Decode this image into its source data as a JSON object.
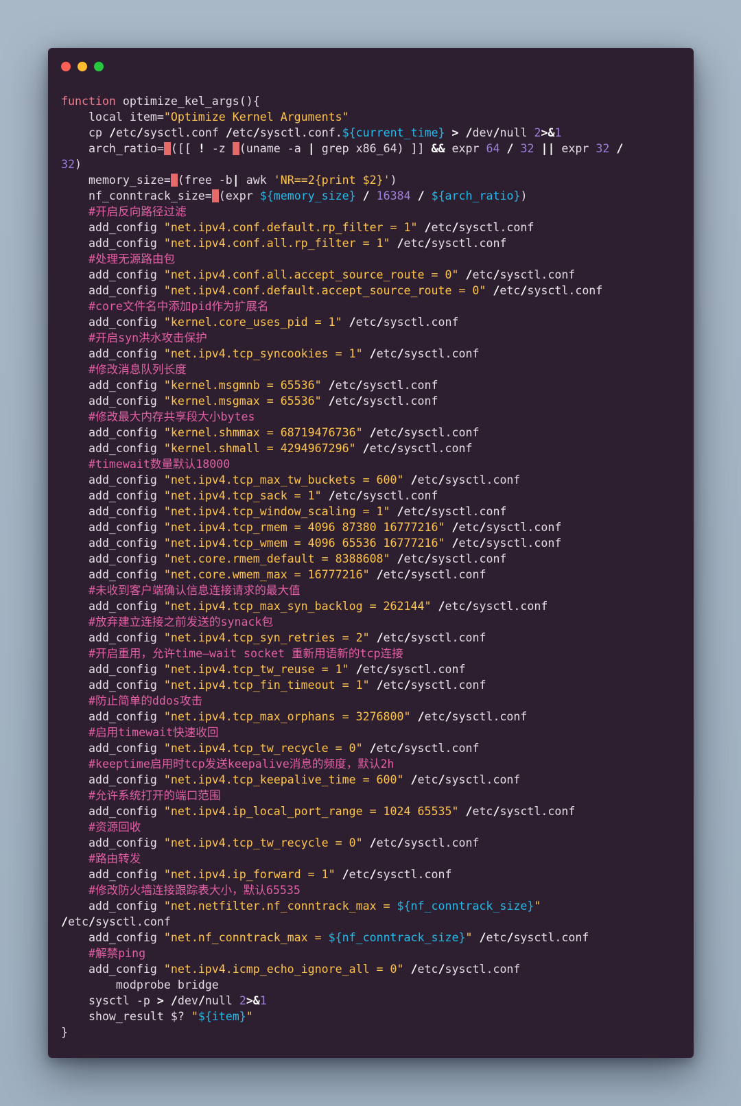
{
  "window": {
    "controls": [
      {
        "name": "close",
        "color": "#fd5f57"
      },
      {
        "name": "minimize",
        "color": "#febc2e"
      },
      {
        "name": "maximize",
        "color": "#27c840"
      }
    ]
  },
  "colors": {
    "background": "#2d1f2f",
    "keyword": "#f27d8e",
    "string": "#fcc34e",
    "variable": "#25b8e8",
    "number": "#9f7fd9",
    "comment": "#e35fa5",
    "text": "#e5dce6"
  },
  "code": {
    "lines": [
      [
        [
          "kw",
          "function"
        ],
        [
          "t",
          " optimize_kel_args(){"
        ]
      ],
      [
        [
          "t",
          "    local item="
        ],
        [
          "str",
          "\"Optimize Kernel Arguments\""
        ]
      ],
      [
        [
          "t",
          "    cp "
        ],
        [
          "op",
          "/"
        ],
        [
          "t",
          "etc"
        ],
        [
          "op",
          "/"
        ],
        [
          "t",
          "sysctl.conf "
        ],
        [
          "op",
          "/"
        ],
        [
          "t",
          "etc"
        ],
        [
          "op",
          "/"
        ],
        [
          "t",
          "sysctl.conf."
        ],
        [
          "var",
          "${current_time}"
        ],
        [
          "t",
          " "
        ],
        [
          "op",
          ">"
        ],
        [
          "t",
          " "
        ],
        [
          "op",
          "/"
        ],
        [
          "t",
          "dev"
        ],
        [
          "op",
          "/"
        ],
        [
          "t",
          "null "
        ],
        [
          "num",
          "2"
        ],
        [
          "op",
          ">&"
        ],
        [
          "num",
          "1"
        ]
      ],
      [
        [
          "t",
          "    arch_ratio="
        ],
        [
          "hl",
          "$"
        ],
        [
          "t",
          "([[ "
        ],
        [
          "op",
          "!"
        ],
        [
          "t",
          " -z "
        ],
        [
          "hl",
          "$"
        ],
        [
          "t",
          "(uname -a "
        ],
        [
          "op",
          "|"
        ],
        [
          "t",
          " grep x86_64) ]] "
        ],
        [
          "op",
          "&&"
        ],
        [
          "t",
          " expr "
        ],
        [
          "num",
          "64"
        ],
        [
          "t",
          " "
        ],
        [
          "op",
          "/"
        ],
        [
          "t",
          " "
        ],
        [
          "num",
          "32"
        ],
        [
          "t",
          " "
        ],
        [
          "op",
          "||"
        ],
        [
          "t",
          " expr "
        ],
        [
          "num",
          "32"
        ],
        [
          "t",
          " "
        ],
        [
          "op",
          "/"
        ]
      ],
      [
        [
          "num",
          "32"
        ],
        [
          "t",
          ")"
        ]
      ],
      [
        [
          "t",
          "    memory_size="
        ],
        [
          "hl",
          "$"
        ],
        [
          "t",
          "(free -b"
        ],
        [
          "op",
          "|"
        ],
        [
          "t",
          " awk "
        ],
        [
          "str",
          "'NR==2{print $2}'"
        ],
        [
          "t",
          ")"
        ]
      ],
      [
        [
          "t",
          "    nf_conntrack_size="
        ],
        [
          "hl",
          "$"
        ],
        [
          "t",
          "(expr "
        ],
        [
          "var",
          "${memory_size}"
        ],
        [
          "t",
          " "
        ],
        [
          "op",
          "/"
        ],
        [
          "t",
          " "
        ],
        [
          "num",
          "16384"
        ],
        [
          "t",
          " "
        ],
        [
          "op",
          "/"
        ],
        [
          "t",
          " "
        ],
        [
          "var",
          "${arch_ratio}"
        ],
        [
          "t",
          ")"
        ]
      ],
      [
        [
          "cmt",
          "    #开启反向路径过滤"
        ]
      ],
      [
        [
          "t",
          "    add_config "
        ],
        [
          "str",
          "\"net.ipv4.conf.default.rp_filter = 1\""
        ],
        [
          "t",
          " "
        ],
        [
          "op",
          "/"
        ],
        [
          "t",
          "etc"
        ],
        [
          "op",
          "/"
        ],
        [
          "t",
          "sysctl.conf"
        ]
      ],
      [
        [
          "t",
          "    add_config "
        ],
        [
          "str",
          "\"net.ipv4.conf.all.rp_filter = 1\""
        ],
        [
          "t",
          " "
        ],
        [
          "op",
          "/"
        ],
        [
          "t",
          "etc"
        ],
        [
          "op",
          "/"
        ],
        [
          "t",
          "sysctl.conf"
        ]
      ],
      [
        [
          "cmt",
          "    #处理无源路由包"
        ]
      ],
      [
        [
          "t",
          "    add_config "
        ],
        [
          "str",
          "\"net.ipv4.conf.all.accept_source_route = 0\""
        ],
        [
          "t",
          " "
        ],
        [
          "op",
          "/"
        ],
        [
          "t",
          "etc"
        ],
        [
          "op",
          "/"
        ],
        [
          "t",
          "sysctl.conf"
        ]
      ],
      [
        [
          "t",
          "    add_config "
        ],
        [
          "str",
          "\"net.ipv4.conf.default.accept_source_route = 0\""
        ],
        [
          "t",
          " "
        ],
        [
          "op",
          "/"
        ],
        [
          "t",
          "etc"
        ],
        [
          "op",
          "/"
        ],
        [
          "t",
          "sysctl.conf"
        ]
      ],
      [
        [
          "cmt",
          "    #core文件名中添加pid作为扩展名"
        ]
      ],
      [
        [
          "t",
          "    add_config "
        ],
        [
          "str",
          "\"kernel.core_uses_pid = 1\""
        ],
        [
          "t",
          " "
        ],
        [
          "op",
          "/"
        ],
        [
          "t",
          "etc"
        ],
        [
          "op",
          "/"
        ],
        [
          "t",
          "sysctl.conf"
        ]
      ],
      [
        [
          "cmt",
          "    #开启syn洪水攻击保护"
        ]
      ],
      [
        [
          "t",
          "    add_config "
        ],
        [
          "str",
          "\"net.ipv4.tcp_syncookies = 1\""
        ],
        [
          "t",
          " "
        ],
        [
          "op",
          "/"
        ],
        [
          "t",
          "etc"
        ],
        [
          "op",
          "/"
        ],
        [
          "t",
          "sysctl.conf"
        ]
      ],
      [
        [
          "cmt",
          "    #修改消息队列长度"
        ]
      ],
      [
        [
          "t",
          "    add_config "
        ],
        [
          "str",
          "\"kernel.msgmnb = 65536\""
        ],
        [
          "t",
          " "
        ],
        [
          "op",
          "/"
        ],
        [
          "t",
          "etc"
        ],
        [
          "op",
          "/"
        ],
        [
          "t",
          "sysctl.conf"
        ]
      ],
      [
        [
          "t",
          "    add_config "
        ],
        [
          "str",
          "\"kernel.msgmax = 65536\""
        ],
        [
          "t",
          " "
        ],
        [
          "op",
          "/"
        ],
        [
          "t",
          "etc"
        ],
        [
          "op",
          "/"
        ],
        [
          "t",
          "sysctl.conf"
        ]
      ],
      [
        [
          "cmt",
          "    #修改最大内存共享段大小bytes"
        ]
      ],
      [
        [
          "t",
          "    add_config "
        ],
        [
          "str",
          "\"kernel.shmmax = 68719476736\""
        ],
        [
          "t",
          " "
        ],
        [
          "op",
          "/"
        ],
        [
          "t",
          "etc"
        ],
        [
          "op",
          "/"
        ],
        [
          "t",
          "sysctl.conf"
        ]
      ],
      [
        [
          "t",
          "    add_config "
        ],
        [
          "str",
          "\"kernel.shmall = 4294967296\""
        ],
        [
          "t",
          " "
        ],
        [
          "op",
          "/"
        ],
        [
          "t",
          "etc"
        ],
        [
          "op",
          "/"
        ],
        [
          "t",
          "sysctl.conf"
        ]
      ],
      [
        [
          "cmt",
          "    #timewait数量默认18000"
        ]
      ],
      [
        [
          "t",
          "    add_config "
        ],
        [
          "str",
          "\"net.ipv4.tcp_max_tw_buckets = 600\""
        ],
        [
          "t",
          " "
        ],
        [
          "op",
          "/"
        ],
        [
          "t",
          "etc"
        ],
        [
          "op",
          "/"
        ],
        [
          "t",
          "sysctl.conf"
        ]
      ],
      [
        [
          "t",
          "    add_config "
        ],
        [
          "str",
          "\"net.ipv4.tcp_sack = 1\""
        ],
        [
          "t",
          " "
        ],
        [
          "op",
          "/"
        ],
        [
          "t",
          "etc"
        ],
        [
          "op",
          "/"
        ],
        [
          "t",
          "sysctl.conf"
        ]
      ],
      [
        [
          "t",
          "    add_config "
        ],
        [
          "str",
          "\"net.ipv4.tcp_window_scaling = 1\""
        ],
        [
          "t",
          " "
        ],
        [
          "op",
          "/"
        ],
        [
          "t",
          "etc"
        ],
        [
          "op",
          "/"
        ],
        [
          "t",
          "sysctl.conf"
        ]
      ],
      [
        [
          "t",
          "    add_config "
        ],
        [
          "str",
          "\"net.ipv4.tcp_rmem = 4096 87380 16777216\""
        ],
        [
          "t",
          " "
        ],
        [
          "op",
          "/"
        ],
        [
          "t",
          "etc"
        ],
        [
          "op",
          "/"
        ],
        [
          "t",
          "sysctl.conf"
        ]
      ],
      [
        [
          "t",
          "    add_config "
        ],
        [
          "str",
          "\"net.ipv4.tcp_wmem = 4096 65536 16777216\""
        ],
        [
          "t",
          " "
        ],
        [
          "op",
          "/"
        ],
        [
          "t",
          "etc"
        ],
        [
          "op",
          "/"
        ],
        [
          "t",
          "sysctl.conf"
        ]
      ],
      [
        [
          "t",
          "    add_config "
        ],
        [
          "str",
          "\"net.core.rmem_default = 8388608\""
        ],
        [
          "t",
          " "
        ],
        [
          "op",
          "/"
        ],
        [
          "t",
          "etc"
        ],
        [
          "op",
          "/"
        ],
        [
          "t",
          "sysctl.conf"
        ]
      ],
      [
        [
          "t",
          "    add_config "
        ],
        [
          "str",
          "\"net.core.wmem_max = 16777216\""
        ],
        [
          "t",
          " "
        ],
        [
          "op",
          "/"
        ],
        [
          "t",
          "etc"
        ],
        [
          "op",
          "/"
        ],
        [
          "t",
          "sysctl.conf"
        ]
      ],
      [
        [
          "cmt",
          "    #未收到客户端确认信息连接请求的最大值"
        ]
      ],
      [
        [
          "t",
          "    add_config "
        ],
        [
          "str",
          "\"net.ipv4.tcp_max_syn_backlog = 262144\""
        ],
        [
          "t",
          " "
        ],
        [
          "op",
          "/"
        ],
        [
          "t",
          "etc"
        ],
        [
          "op",
          "/"
        ],
        [
          "t",
          "sysctl.conf"
        ]
      ],
      [
        [
          "cmt",
          "    #放弃建立连接之前发送的synack包"
        ]
      ],
      [
        [
          "t",
          "    add_config "
        ],
        [
          "str",
          "\"net.ipv4.tcp_syn_retries = 2\""
        ],
        [
          "t",
          " "
        ],
        [
          "op",
          "/"
        ],
        [
          "t",
          "etc"
        ],
        [
          "op",
          "/"
        ],
        [
          "t",
          "sysctl.conf"
        ]
      ],
      [
        [
          "cmt",
          "    #开启重用，允许time—wait socket 重新用语新的tcp连接"
        ]
      ],
      [
        [
          "t",
          "    add_config "
        ],
        [
          "str",
          "\"net.ipv4.tcp_tw_reuse = 1\""
        ],
        [
          "t",
          " "
        ],
        [
          "op",
          "/"
        ],
        [
          "t",
          "etc"
        ],
        [
          "op",
          "/"
        ],
        [
          "t",
          "sysctl.conf"
        ]
      ],
      [
        [
          "t",
          "    add_config "
        ],
        [
          "str",
          "\"net.ipv4.tcp_fin_timeout = 1\""
        ],
        [
          "t",
          " "
        ],
        [
          "op",
          "/"
        ],
        [
          "t",
          "etc"
        ],
        [
          "op",
          "/"
        ],
        [
          "t",
          "sysctl.conf"
        ]
      ],
      [
        [
          "cmt",
          "    #防止简单的ddos攻击"
        ]
      ],
      [
        [
          "t",
          "    add_config "
        ],
        [
          "str",
          "\"net.ipv4.tcp_max_orphans = 3276800\""
        ],
        [
          "t",
          " "
        ],
        [
          "op",
          "/"
        ],
        [
          "t",
          "etc"
        ],
        [
          "op",
          "/"
        ],
        [
          "t",
          "sysctl.conf"
        ]
      ],
      [
        [
          "cmt",
          "    #启用timewait快速收回"
        ]
      ],
      [
        [
          "t",
          "    add_config "
        ],
        [
          "str",
          "\"net.ipv4.tcp_tw_recycle = 0\""
        ],
        [
          "t",
          " "
        ],
        [
          "op",
          "/"
        ],
        [
          "t",
          "etc"
        ],
        [
          "op",
          "/"
        ],
        [
          "t",
          "sysctl.conf"
        ]
      ],
      [
        [
          "cmt",
          "    #keeptime启用时tcp发送keepalive消息的频度，默认2h"
        ]
      ],
      [
        [
          "t",
          "    add_config "
        ],
        [
          "str",
          "\"net.ipv4.tcp_keepalive_time = 600\""
        ],
        [
          "t",
          " "
        ],
        [
          "op",
          "/"
        ],
        [
          "t",
          "etc"
        ],
        [
          "op",
          "/"
        ],
        [
          "t",
          "sysctl.conf"
        ]
      ],
      [
        [
          "cmt",
          "    #允许系统打开的端口范围"
        ]
      ],
      [
        [
          "t",
          "    add_config "
        ],
        [
          "str",
          "\"net.ipv4.ip_local_port_range = 1024 65535\""
        ],
        [
          "t",
          " "
        ],
        [
          "op",
          "/"
        ],
        [
          "t",
          "etc"
        ],
        [
          "op",
          "/"
        ],
        [
          "t",
          "sysctl.conf"
        ]
      ],
      [
        [
          "cmt",
          "    #资源回收"
        ]
      ],
      [
        [
          "t",
          "    add_config "
        ],
        [
          "str",
          "\"net.ipv4.tcp_tw_recycle = 0\""
        ],
        [
          "t",
          " "
        ],
        [
          "op",
          "/"
        ],
        [
          "t",
          "etc"
        ],
        [
          "op",
          "/"
        ],
        [
          "t",
          "sysctl.conf"
        ]
      ],
      [
        [
          "cmt",
          "    #路由转发"
        ]
      ],
      [
        [
          "t",
          "    add_config "
        ],
        [
          "str",
          "\"net.ipv4.ip_forward = 1\""
        ],
        [
          "t",
          " "
        ],
        [
          "op",
          "/"
        ],
        [
          "t",
          "etc"
        ],
        [
          "op",
          "/"
        ],
        [
          "t",
          "sysctl.conf"
        ]
      ],
      [
        [
          "cmt",
          "    #修改防火墙连接跟踪表大小，默认65535"
        ]
      ],
      [
        [
          "t",
          "    add_config "
        ],
        [
          "str",
          "\"net.netfilter.nf_conntrack_max = "
        ],
        [
          "var",
          "${nf_conntrack_size}"
        ],
        [
          "str",
          "\""
        ]
      ],
      [
        [
          "op",
          "/"
        ],
        [
          "t",
          "etc"
        ],
        [
          "op",
          "/"
        ],
        [
          "t",
          "sysctl.conf"
        ]
      ],
      [
        [
          "t",
          "    add_config "
        ],
        [
          "str",
          "\"net.nf_conntrack_max = "
        ],
        [
          "var",
          "${nf_conntrack_size}"
        ],
        [
          "str",
          "\""
        ],
        [
          "t",
          " "
        ],
        [
          "op",
          "/"
        ],
        [
          "t",
          "etc"
        ],
        [
          "op",
          "/"
        ],
        [
          "t",
          "sysctl.conf"
        ]
      ],
      [
        [
          "cmt",
          "    #解禁ping"
        ]
      ],
      [
        [
          "t",
          "    add_config "
        ],
        [
          "str",
          "\"net.ipv4.icmp_echo_ignore_all = 0\""
        ],
        [
          "t",
          " "
        ],
        [
          "op",
          "/"
        ],
        [
          "t",
          "etc"
        ],
        [
          "op",
          "/"
        ],
        [
          "t",
          "sysctl.conf"
        ]
      ],
      [
        [
          "t",
          "        modprobe bridge"
        ]
      ],
      [
        [
          "t",
          "    sysctl -p "
        ],
        [
          "op",
          ">"
        ],
        [
          "t",
          " "
        ],
        [
          "op",
          "/"
        ],
        [
          "t",
          "dev"
        ],
        [
          "op",
          "/"
        ],
        [
          "t",
          "null "
        ],
        [
          "num",
          "2"
        ],
        [
          "op",
          ">&"
        ],
        [
          "num",
          "1"
        ]
      ],
      [
        [
          "t",
          "    show_result $? "
        ],
        [
          "str",
          "\""
        ],
        [
          "var",
          "${item}"
        ],
        [
          "str",
          "\""
        ]
      ],
      [
        [
          "t",
          "}"
        ]
      ]
    ]
  }
}
